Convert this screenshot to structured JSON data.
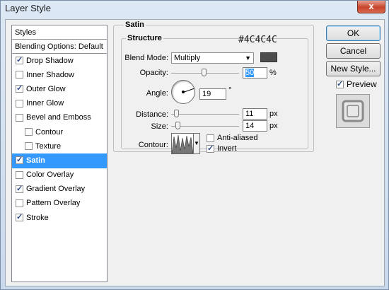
{
  "window": {
    "title": "Layer Style",
    "close_glyph": "x"
  },
  "styles_list": {
    "header": "Styles",
    "blending": "Blending Options: Default",
    "items": [
      {
        "label": "Drop Shadow",
        "checked": true
      },
      {
        "label": "Inner Shadow",
        "checked": false
      },
      {
        "label": "Outer Glow",
        "checked": true
      },
      {
        "label": "Inner Glow",
        "checked": false
      },
      {
        "label": "Bevel and Emboss",
        "checked": false
      },
      {
        "label": "Contour",
        "checked": false
      },
      {
        "label": "Texture",
        "checked": false
      },
      {
        "label": "Satin",
        "checked": true,
        "selected": true
      },
      {
        "label": "Color Overlay",
        "checked": false
      },
      {
        "label": "Gradient Overlay",
        "checked": true
      },
      {
        "label": "Pattern Overlay",
        "checked": false
      },
      {
        "label": "Stroke",
        "checked": true
      }
    ]
  },
  "satin": {
    "group_title": "Satin",
    "structure_title": "Structure",
    "blend_mode_label": "Blend Mode:",
    "blend_mode": "Multiply",
    "color_note": "#4C4C4C",
    "color": "#4c4c4c",
    "opacity_label": "Opacity:",
    "opacity": "50",
    "opacity_unit": "%",
    "angle_label": "Angle:",
    "angle": "19",
    "angle_unit": "°",
    "distance_label": "Distance:",
    "distance": "11",
    "distance_unit": "px",
    "size_label": "Size:",
    "size": "14",
    "size_unit": "px",
    "contour_label": "Contour:",
    "anti_aliased_label": "Anti-aliased",
    "anti_aliased": false,
    "invert_label": "Invert",
    "invert": true
  },
  "buttons": {
    "ok": "OK",
    "cancel": "Cancel",
    "new_style": "New Style...",
    "preview_label": "Preview",
    "preview_checked": true
  },
  "colors": {
    "selection": "#3399ff",
    "swatch": "#4c4c4c"
  }
}
